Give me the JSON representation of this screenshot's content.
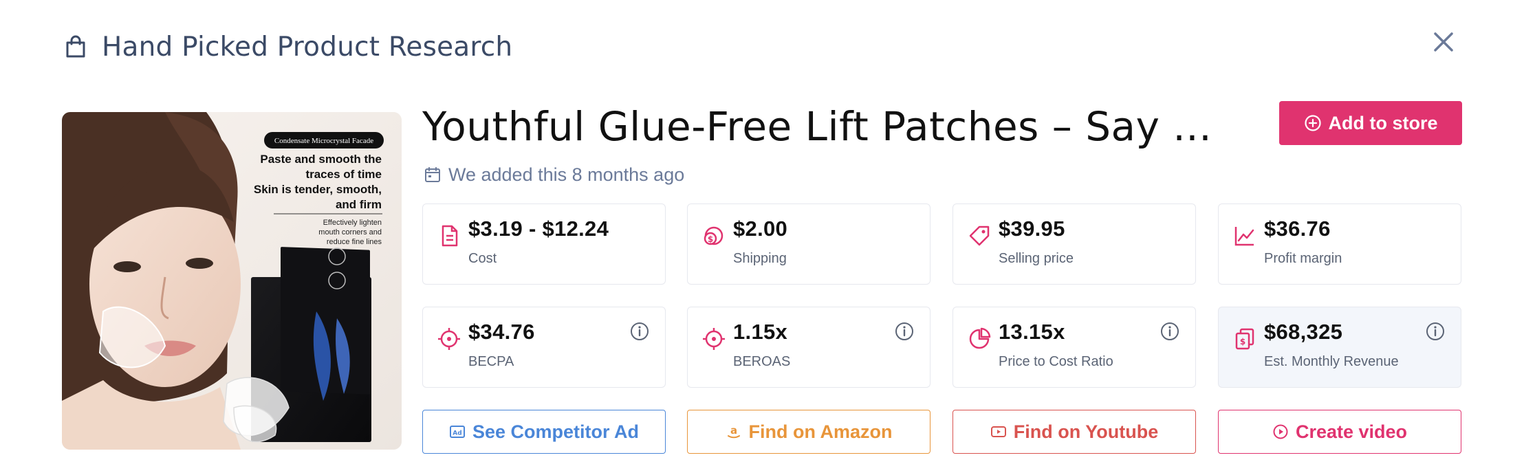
{
  "header": {
    "title": "Hand Picked Product Research"
  },
  "product": {
    "title": "Youthful Glue-Free Lift Patches – Say ...",
    "added_text": "We added this 8 months ago",
    "add_button_label": "Add to store",
    "image": {
      "badge": "Condensate Microcrystal Facade",
      "headline_1": "Paste and smooth the",
      "headline_2": "traces of time",
      "headline_3": "Skin is tender, smooth,",
      "headline_4": "and firm",
      "sub_1": "Effectively lighten",
      "sub_2": "mouth corners and",
      "sub_3": "reduce fine lines"
    }
  },
  "stats_row1": [
    {
      "value": "$3.19 - $12.24",
      "label": "Cost",
      "icon": "document-icon"
    },
    {
      "value": "$2.00",
      "label": "Shipping",
      "icon": "coins-icon"
    },
    {
      "value": "$39.95",
      "label": "Selling price",
      "icon": "tag-icon"
    },
    {
      "value": "$36.76",
      "label": "Profit margin",
      "icon": "chart-line-icon"
    }
  ],
  "stats_row2": [
    {
      "value": "$34.76",
      "label": "BECPA",
      "icon": "crosshair-icon"
    },
    {
      "value": "1.15x",
      "label": "BEROAS",
      "icon": "crosshair-icon"
    },
    {
      "value": "13.15x",
      "label": "Price to Cost Ratio",
      "icon": "pie-chart-icon"
    },
    {
      "value": "$68,325",
      "label": "Est. Monthly Revenue",
      "icon": "money-stack-icon"
    }
  ],
  "actions": [
    {
      "label": "See Competitor Ad",
      "icon": "ad-icon",
      "color": "#4a86d8"
    },
    {
      "label": "Find on Amazon",
      "icon": "amazon-icon",
      "color": "#e8953a"
    },
    {
      "label": "Find on Youtube",
      "icon": "youtube-icon",
      "color": "#d9534f"
    },
    {
      "label": "Create video",
      "icon": "play-circle-icon",
      "color": "#e0336f"
    }
  ],
  "colors": {
    "accent": "#e0336f",
    "title": "#3b4a66",
    "muted": "#6b7a99"
  }
}
